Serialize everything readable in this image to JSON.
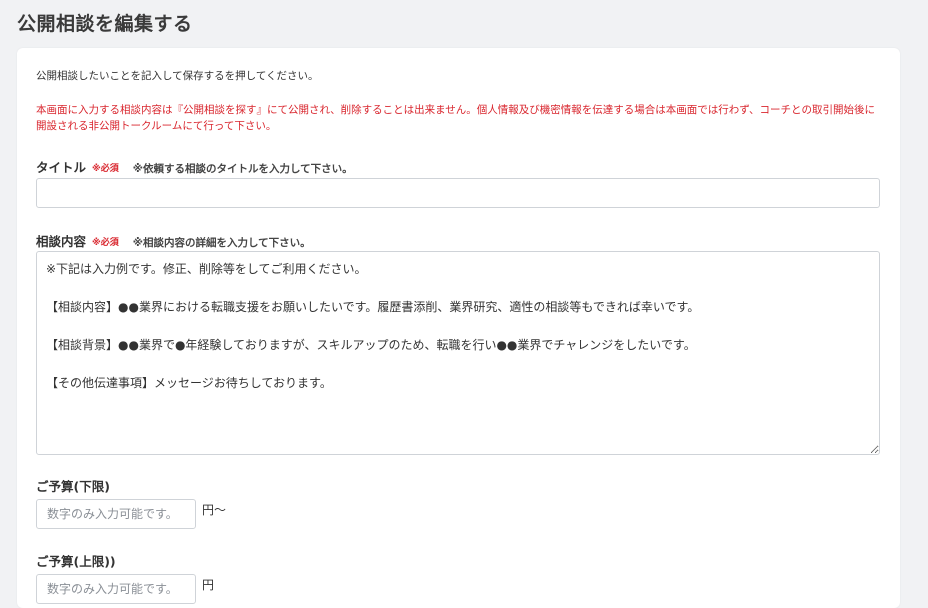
{
  "page": {
    "title": "公開相談を編集する"
  },
  "form": {
    "intro": "公開相談したいことを記入して保存するを押してください。",
    "warning": "本画面に入力する相談内容は『公開相談を探す』にて公開され、削除することは出来ません。個人情報及び機密情報を伝達する場合は本画面では行わず、コーチとの取引開始後に開設される非公開トークルームにて行って下さい。",
    "title_field": {
      "label": "タイトル",
      "required": "※必須",
      "hint": "※依頼する相談のタイトルを入力して下さい。",
      "value": ""
    },
    "content_field": {
      "label": "相談内容",
      "required": "※必須",
      "hint": "※相談内容の詳細を入力して下さい。",
      "value": "※下記は入力例です。修正、削除等をしてご利用ください。\n\n【相談内容】●●業界における転職支援をお願いしたいです。履歴書添削、業界研究、適性の相談等もできれば幸いです。\n\n【相談背景】●●業界で●年経験しておりますが、スキルアップのため、転職を行い●●業界でチャレンジをしたいです。\n\n【その他伝達事項】メッセージお待ちしております。"
    },
    "budget_min": {
      "label": "ご予算(下限)",
      "placeholder": "数字のみ入力可能です。",
      "unit": "円〜"
    },
    "budget_max": {
      "label": "ご予算(上限))",
      "placeholder": "数字のみ入力可能です。",
      "unit": "円"
    }
  }
}
